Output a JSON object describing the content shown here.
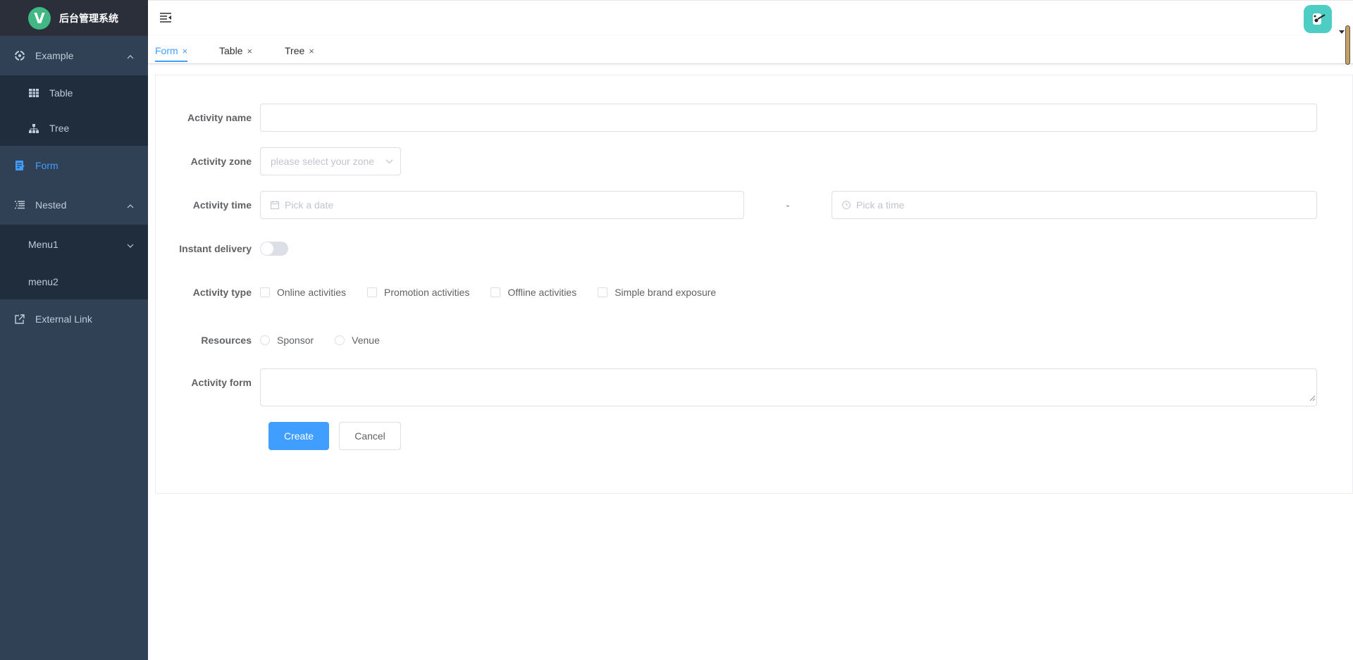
{
  "brand": {
    "logo_letter": "V",
    "title": "后台管理系统"
  },
  "sidebar": {
    "example": {
      "label": "Example",
      "children": {
        "table": "Table",
        "tree": "Tree"
      }
    },
    "form": "Form",
    "nested": {
      "label": "Nested",
      "children": {
        "menu1": "Menu1",
        "menu2": "menu2"
      }
    },
    "external": "External Link"
  },
  "tabs": [
    {
      "label": "Form",
      "active": true
    },
    {
      "label": "Table",
      "active": false
    },
    {
      "label": "Tree",
      "active": false
    }
  ],
  "tab_close": "×",
  "form": {
    "name": {
      "label": "Activity name",
      "value": ""
    },
    "zone": {
      "label": "Activity zone",
      "placeholder": "please select your zone"
    },
    "time": {
      "label": "Activity time",
      "date_placeholder": "Pick a date",
      "separator": "-",
      "time_placeholder": "Pick a time"
    },
    "delivery": {
      "label": "Instant delivery",
      "on": false
    },
    "type": {
      "label": "Activity type",
      "options": [
        "Online activities",
        "Promotion activities",
        "Offline activities",
        "Simple brand exposure"
      ]
    },
    "resources": {
      "label": "Resources",
      "options": [
        "Sponsor",
        "Venue"
      ]
    },
    "desc": {
      "label": "Activity form",
      "value": ""
    },
    "create_label": "Create",
    "cancel_label": "Cancel"
  },
  "colors": {
    "sidebar_bg": "#304156",
    "submenu_bg": "#1f2d3d",
    "brand_bg": "#2b2f3a",
    "accent": "#409eff"
  }
}
